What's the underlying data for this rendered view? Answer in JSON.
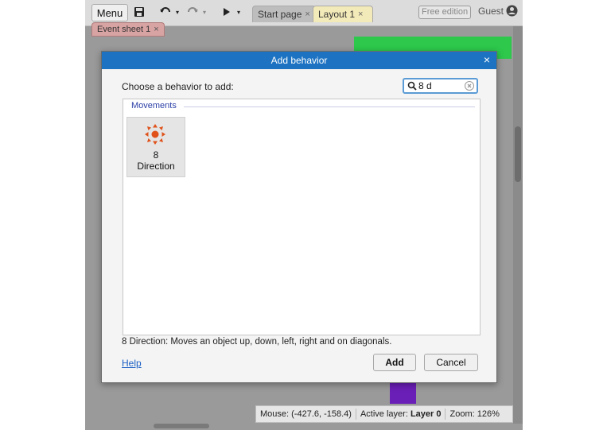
{
  "toolbar": {
    "menu_label": "Menu",
    "tabs": [
      {
        "label": "Start page",
        "close": "×"
      },
      {
        "label": "Layout 1",
        "close": "×"
      }
    ],
    "edition_badge": "Free edition",
    "user_label": "Guest"
  },
  "subtabs": [
    {
      "label": "Event sheet 1",
      "close": "×"
    }
  ],
  "dialog": {
    "title": "Add behavior",
    "close_glyph": "×",
    "prompt": "Choose a behavior to add:",
    "search": {
      "value": "8 d",
      "placeholder": ""
    },
    "category": "Movements",
    "behaviors": [
      {
        "name_line1": "8",
        "name_line2": "Direction",
        "icon": "eight-direction-icon"
      }
    ],
    "description": "8 Direction: Moves an object up, down, left, right and on diagonals.",
    "help_label": "Help",
    "add_label": "Add",
    "cancel_label": "Cancel"
  },
  "status": {
    "mouse_label": "Mouse:",
    "mouse_value": "(-427.6, -158.4)",
    "layer_label": "Active layer:",
    "layer_value": "Layer 0",
    "zoom_label": "Zoom:",
    "zoom_value": "126%"
  },
  "colors": {
    "accent": "#1d73c2",
    "canvas_green": "#2dc84c",
    "canvas_purple": "#6a1fb6",
    "icon_orange": "#e0521a"
  }
}
